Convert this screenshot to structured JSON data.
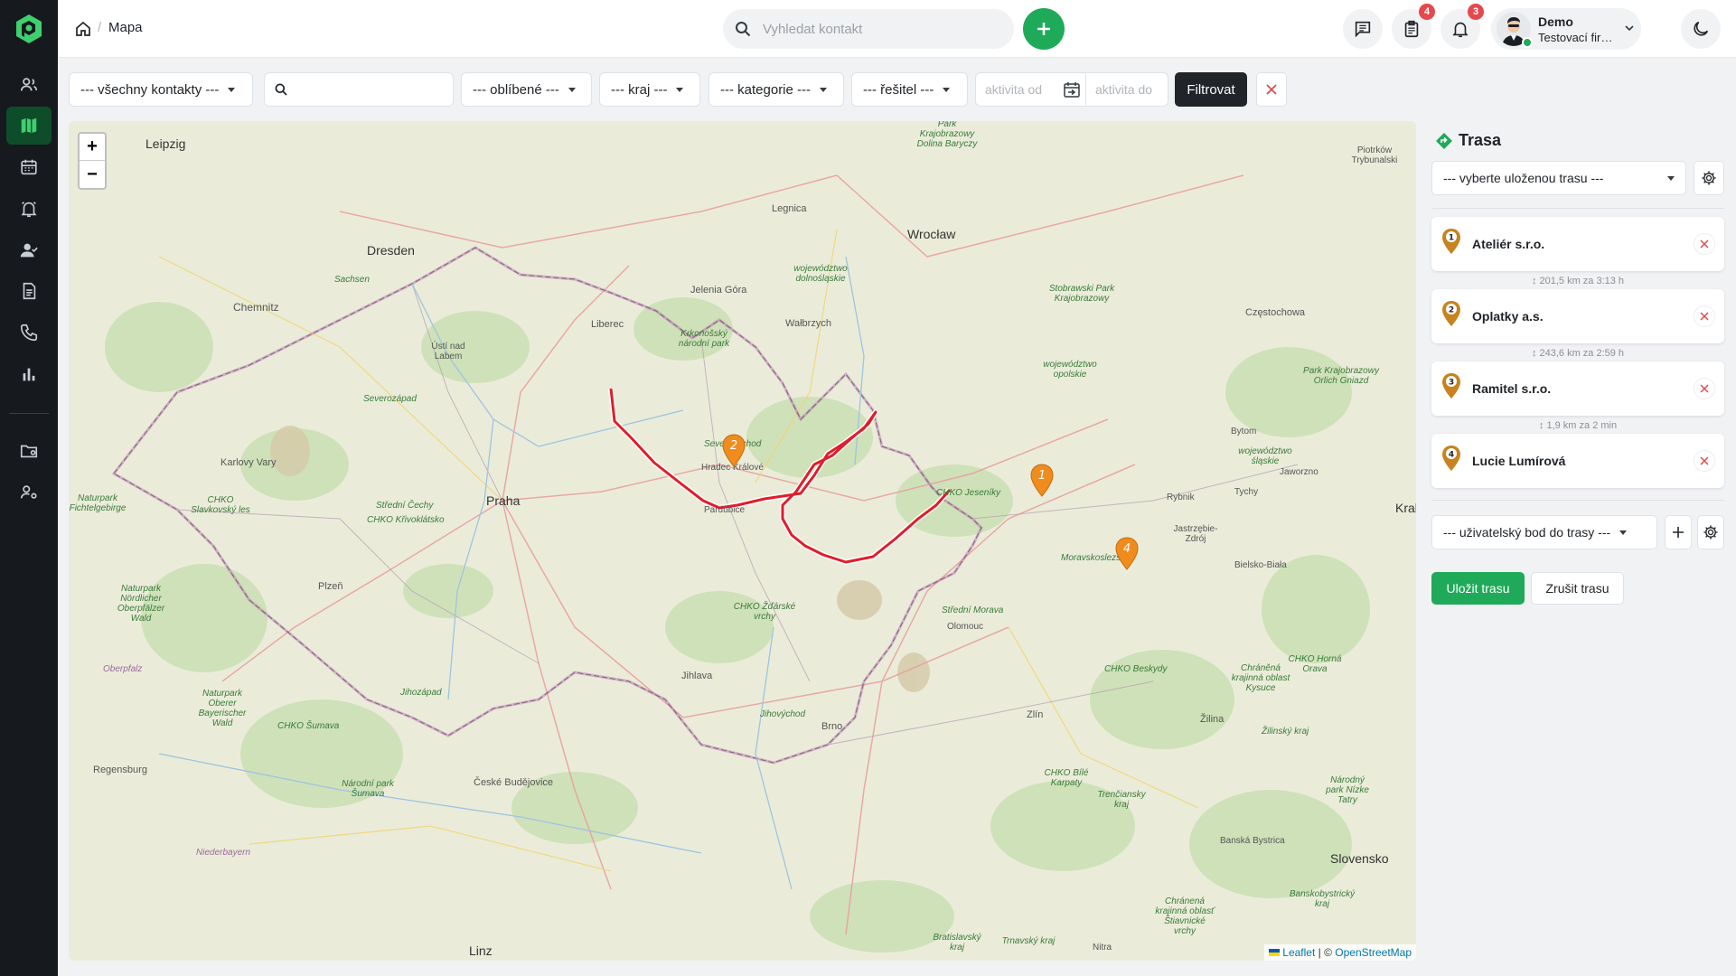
{
  "breadcrumb": {
    "current": "Mapa"
  },
  "search": {
    "placeholder": "Vyhledat kontakt"
  },
  "header": {
    "tasks_badge": "4",
    "notifications_badge": "3"
  },
  "user": {
    "name": "Demo",
    "company": "Testovací firma s.r..."
  },
  "filters": {
    "contacts": "--- všechny kontakty ---",
    "favorites": "--- oblíbené ---",
    "region": "--- kraj ---",
    "category": "--- kategorie ---",
    "assignee": "--- řešitel ---",
    "activity_from_placeholder": "aktivita od",
    "activity_to_placeholder": "aktivita do",
    "filter_label": "Filtrovat"
  },
  "map": {
    "zoom_in": "+",
    "zoom_out": "−",
    "attribution_leaflet": "Leaflet",
    "attribution_sep": " | © ",
    "attribution_osm": "OpenStreetMap",
    "markers": [
      "1",
      "2",
      "4"
    ],
    "labels": {
      "leipzig": "Leipzig",
      "dresden": "Dresden",
      "sachsen": "Sachsen",
      "chemnitz": "Chemnitz",
      "usti": "Ústí nad Labem",
      "liberec": "Liberec",
      "jelenia": "Jelenia Góra",
      "legnica": "Legnica",
      "wroclaw": "Wrocław",
      "walbrzych": "Wałbrzych",
      "wojdoln": "województwo dolnośląskie",
      "krkonose": "Krkonošský národní park",
      "stobrawski": "Stobrawski Park Krajobrazowy",
      "wojopol": "województwo opolskie",
      "czestochowa": "Częstochowa",
      "piotrkow": "Piotrków Trybunalski",
      "karlovy": "Karlovy Vary",
      "severozapad": "Severozápad",
      "praha": "Praha",
      "stredni": "Střední Čechy",
      "krivoklat": "CHKO Křivoklátsko",
      "hradec": "Hradec Králové",
      "pardubice": "Pardubice",
      "jeseniky": "CHKO Jeseníky",
      "zdarske": "CHKO Žďárské vrchy",
      "stredni_morava": "Střední Morava",
      "olomouc": "Olomouc",
      "moravskoslezsko": "Moravskoslezsko",
      "bytom": "Bytom",
      "rybnik": "Rybnik",
      "jastrzebie": "Jastrzębie-Zdrój",
      "tychy": "Tychy",
      "jaworzno": "Jaworzno",
      "bielsko": "Bielsko-Biała",
      "krakow": "Krak",
      "plzen": "Plzeň",
      "jihozapad": "Jihozápad",
      "jihlava": "Jihlava",
      "vysocina": "Jihovýchod",
      "brno": "Brno",
      "zlin": "Zlín",
      "zilina": "Žilina",
      "beskydy": "CHKO Beskydy",
      "sumava": "CHKO Šumava",
      "ceske_budejovice": "České Budějovice",
      "regensburg": "Regensburg",
      "niederbayern": "Niederbayern",
      "oberpfalz": "Oberpfalz",
      "linz": "Linz",
      "banska": "Banská Bystrica",
      "slovensko": "Slovensko",
      "nitra": "Nitra",
      "trencin": "Trenčiansky kraj",
      "bile_karpaty": "CHKO Bílé Karpaty",
      "zilinsky": "Žilinský kraj",
      "bavaria": "Naturpark Oberer Bayerischer Wald",
      "sumava_np": "Národní park Šumava",
      "slavkovsky": "CHKO Slavkovský les",
      "fichtelgebirge": "Naturpark Fichtelgebirge",
      "oberpfalzer": "Naturpark Nördlicher Oberpfälzer Wald",
      "lubusz": "Park Krajobrazowy Dolina Baryczy",
      "ochrany": "Chráněná krajinná oblast Kysuce",
      "horna_orava": "CHKO Horná Orava",
      "nizke_tatry": "Národný park Nízke Tatry",
      "banskobystricky": "Banskobystrický kraj",
      "stiavnicke": "Chránená krajinná oblasť Štiavnické vrchy",
      "bratislavsky": "Bratislavský kraj",
      "trnavsky": "Trnavský kraj",
      "slaskie": "województwo śląskie",
      "orlich": "Park Krajobrazowy Orlich Gniazd",
      "severovychod": "Severovýchod"
    }
  },
  "route": {
    "title": "Trasa",
    "saved_route_placeholder": "--- vyberte uloženou trasu ---",
    "stops": [
      {
        "num": "1",
        "name": "Ateliér s.r.o."
      },
      {
        "num": "2",
        "name": "Oplatky a.s."
      },
      {
        "num": "3",
        "name": "Ramitel s.r.o."
      },
      {
        "num": "4",
        "name": "Lucie Lumírová"
      }
    ],
    "legs": [
      "↕ 201,5 km za 3:13 h",
      "↕ 243,6 km za 2:59 h",
      "↕ 1,9 km za 2 min"
    ],
    "custom_point_placeholder": "--- uživatelský bod do trasy ---",
    "save_label": "Uložit trasu",
    "cancel_label": "Zrušit trasu"
  },
  "colors": {
    "accent": "#1faa59",
    "route_line": "#e11d2a",
    "marker": "#f08c1e",
    "sidebar": "#16191d"
  }
}
